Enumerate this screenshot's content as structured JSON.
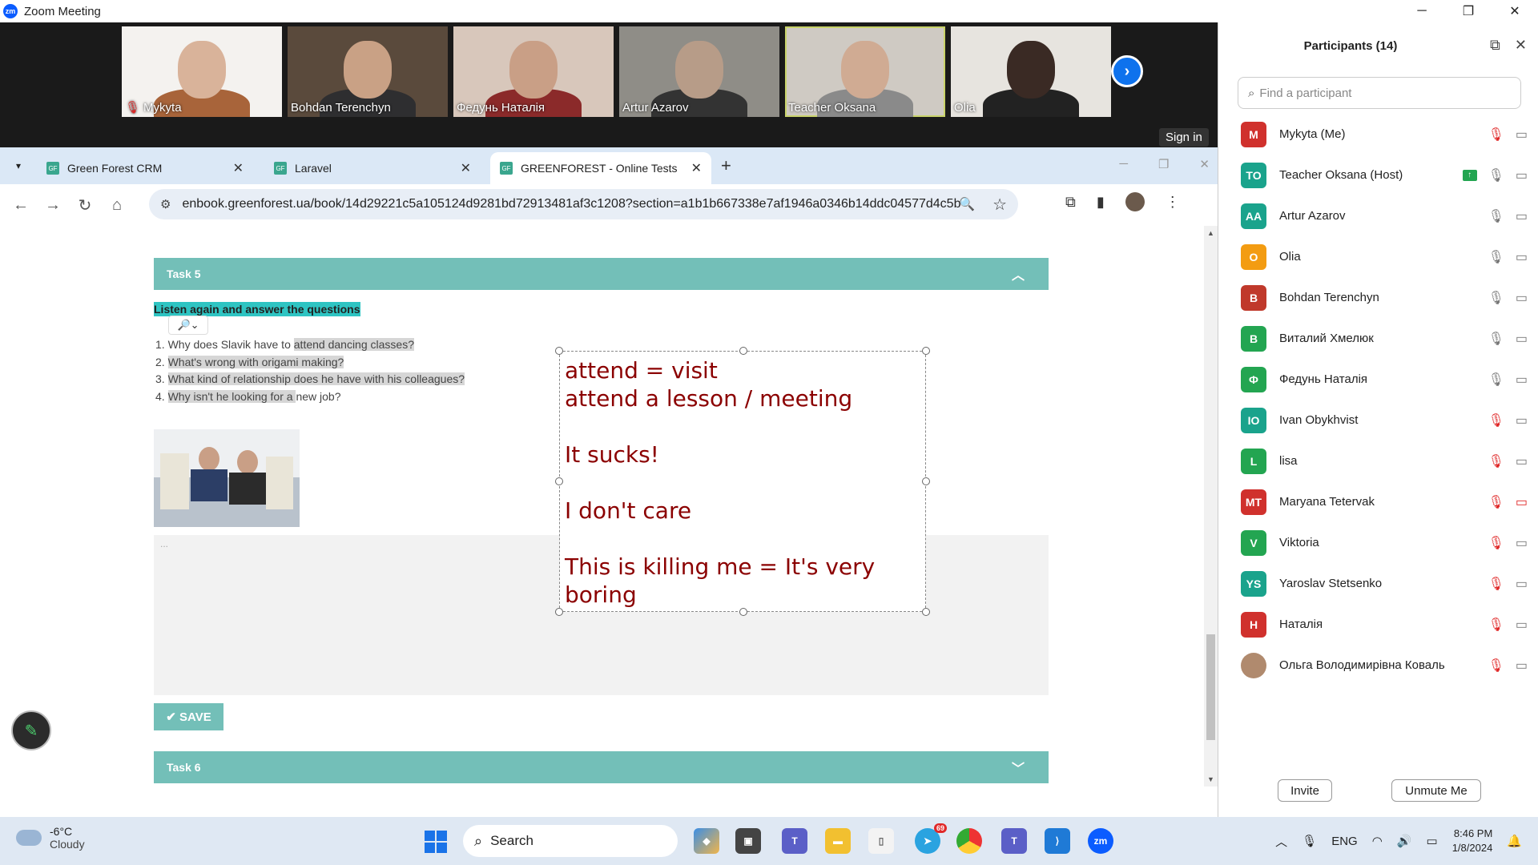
{
  "window": {
    "title": "Zoom Meeting",
    "logo": "zm",
    "controls": [
      "─",
      "❐",
      "✕"
    ]
  },
  "video_strip": {
    "tiles": [
      {
        "name": "Mykyta",
        "muted": true
      },
      {
        "name": "Bohdan Terenchyn",
        "muted": false
      },
      {
        "name": "Федунь Наталія",
        "muted": false
      },
      {
        "name": "Artur Azarov",
        "muted": false
      },
      {
        "name": "Teacher Oksana",
        "muted": false
      },
      {
        "name": "Olia",
        "muted": false
      }
    ],
    "next_icon": "chevron-right-icon",
    "signin_tooltip": "Sign in"
  },
  "browser": {
    "tabs": [
      {
        "label": "Green Forest CRM",
        "favicon": "GF"
      },
      {
        "label": "Laravel",
        "favicon": "GF"
      },
      {
        "label": "GREENFOREST - Online Tests",
        "favicon": "GF"
      }
    ],
    "url": "enbook.greenforest.ua/book/14d29221c5a105124d9281bd72913481af3c1208?section=a1b1b667338e7af1946a0346b14ddc04577d4c5b"
  },
  "page": {
    "task5_label": "Task 5",
    "instruction": "Listen again and answer the questions",
    "questions": [
      {
        "pre": "1. Why does Slavik have to ",
        "hl": "attend dancing classes?"
      },
      {
        "pre": "2. ",
        "hl": "What's wrong with origami making?"
      },
      {
        "pre": "3. ",
        "hl": "What kind of relationship does he have with his colleagues?"
      },
      {
        "pre": "4. ",
        "hl": "Why isn't he looking for a ",
        "post": "new job?"
      }
    ],
    "answer_placeholder": "...",
    "save_label": "SAVE",
    "task6_label": "Task 6",
    "annotation_text": "attend = visit\nattend a lesson / meeting\n\nIt sucks!\n\nI don't care\n\nThis is killing me = It's very\nboring"
  },
  "participants": {
    "title": "Participants (14)",
    "search_placeholder": "Find a participant",
    "list": [
      {
        "name": "Mykyta (Me)",
        "initials": "M",
        "color": "#d0312d",
        "mic_muted": true,
        "cam_off": false
      },
      {
        "name": "Teacher Oksana (Host)",
        "initials": "TO",
        "color": "#1aa38c",
        "mic_muted": false,
        "cam_off": false,
        "sharing": true
      },
      {
        "name": "Artur Azarov",
        "initials": "AA",
        "color": "#1aa38c",
        "mic_muted": false,
        "cam_off": false
      },
      {
        "name": "Olia",
        "initials": "O",
        "color": "#f39c12",
        "mic_muted": false,
        "cam_off": false
      },
      {
        "name": "Bohdan Terenchyn",
        "initials": "B",
        "color": "#c0392b",
        "mic_muted": false,
        "cam_off": false
      },
      {
        "name": "Виталий Хмелюк",
        "initials": "B",
        "color": "#23a551",
        "mic_muted": false,
        "cam_off": false
      },
      {
        "name": "Федунь Наталія",
        "initials": "Ф",
        "color": "#23a551",
        "mic_muted": false,
        "cam_off": false
      },
      {
        "name": "Ivan Obykhvist",
        "initials": "IO",
        "color": "#1aa38c",
        "mic_muted": true,
        "cam_off": false
      },
      {
        "name": "lisa",
        "initials": "L",
        "color": "#23a551",
        "mic_muted": true,
        "cam_off": false
      },
      {
        "name": "Maryana Tetervak",
        "initials": "MT",
        "color": "#d0312d",
        "mic_muted": true,
        "cam_off": true
      },
      {
        "name": "Viktoria",
        "initials": "V",
        "color": "#23a551",
        "mic_muted": true,
        "cam_off": false
      },
      {
        "name": "Yaroslav Stetsenko",
        "initials": "YS",
        "color": "#1aa38c",
        "mic_muted": true,
        "cam_off": false
      },
      {
        "name": "Наталія",
        "initials": "H",
        "color": "#d0312d",
        "mic_muted": true,
        "cam_off": false
      },
      {
        "name": "Ольга Володимирівна Коваль",
        "initials": "",
        "color": "#b08a6e",
        "mic_muted": true,
        "cam_off": false
      }
    ],
    "invite_label": "Invite",
    "unmute_label": "Unmute Me"
  },
  "taskbar": {
    "temperature": "-6°C",
    "condition": "Cloudy",
    "search_label": "Search",
    "language": "ENG",
    "time": "8:46 PM",
    "date": "1/8/2024",
    "telegram_badge": "69"
  }
}
